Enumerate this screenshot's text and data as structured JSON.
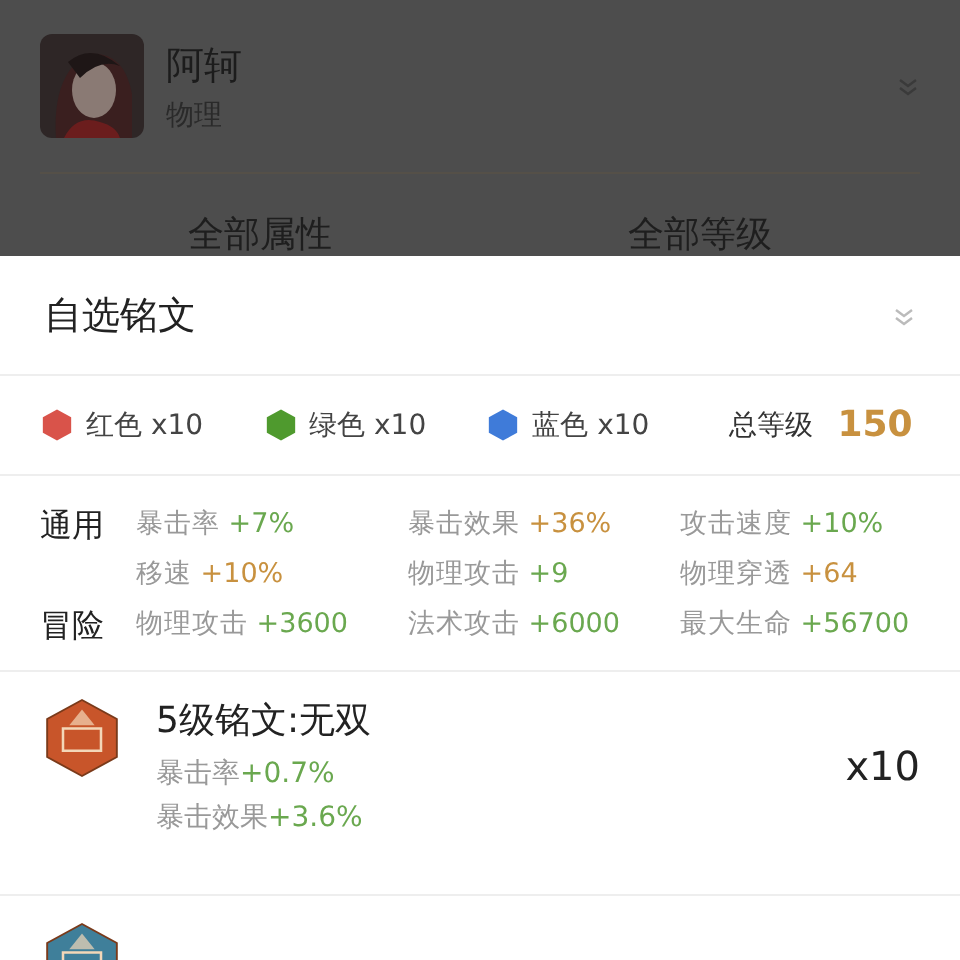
{
  "hero": {
    "name": "阿轲",
    "role": "物理"
  },
  "filters": [
    "全部属性",
    "全部等级"
  ],
  "sheet": {
    "title": "自选铭文",
    "gems": [
      {
        "label": "红色 x10",
        "color": "#d9534a"
      },
      {
        "label": "绿色 x10",
        "color": "#4f9a2e"
      },
      {
        "label": "蓝色 x10",
        "color": "#3f7bd9"
      }
    ],
    "total_label": "总等级",
    "total_value": "150",
    "stat_groups": [
      {
        "label": "通用",
        "stats": [
          {
            "name": "暴击率",
            "value": "+7%",
            "color": "#6aa84f"
          },
          {
            "name": "暴击效果",
            "value": "+36%",
            "color": "#c8913f"
          },
          {
            "name": "攻击速度",
            "value": "+10%",
            "color": "#6aa84f"
          },
          {
            "name": "移速",
            "value": "+10%",
            "color": "#c8913f"
          },
          {
            "name": "物理攻击",
            "value": "+9",
            "color": "#6aa84f"
          },
          {
            "name": "物理穿透",
            "value": "+64",
            "color": "#c8913f"
          }
        ]
      },
      {
        "label": "冒险",
        "stats": [
          {
            "name": "物理攻击",
            "value": "+3600",
            "color": "#6aa84f"
          },
          {
            "name": "法术攻击",
            "value": "+6000",
            "color": "#6aa84f"
          },
          {
            "name": "最大生命",
            "value": "+56700",
            "color": "#6aa84f"
          }
        ]
      }
    ],
    "runes": [
      {
        "name": "5级铭文:无双",
        "color": "#c8552a",
        "effects": [
          {
            "name": "暴击率",
            "value": "+0.7%"
          },
          {
            "name": "暴击效果",
            "value": "+3.6%"
          }
        ],
        "count": "x10"
      },
      {
        "color": "#3f7f9a"
      }
    ]
  }
}
